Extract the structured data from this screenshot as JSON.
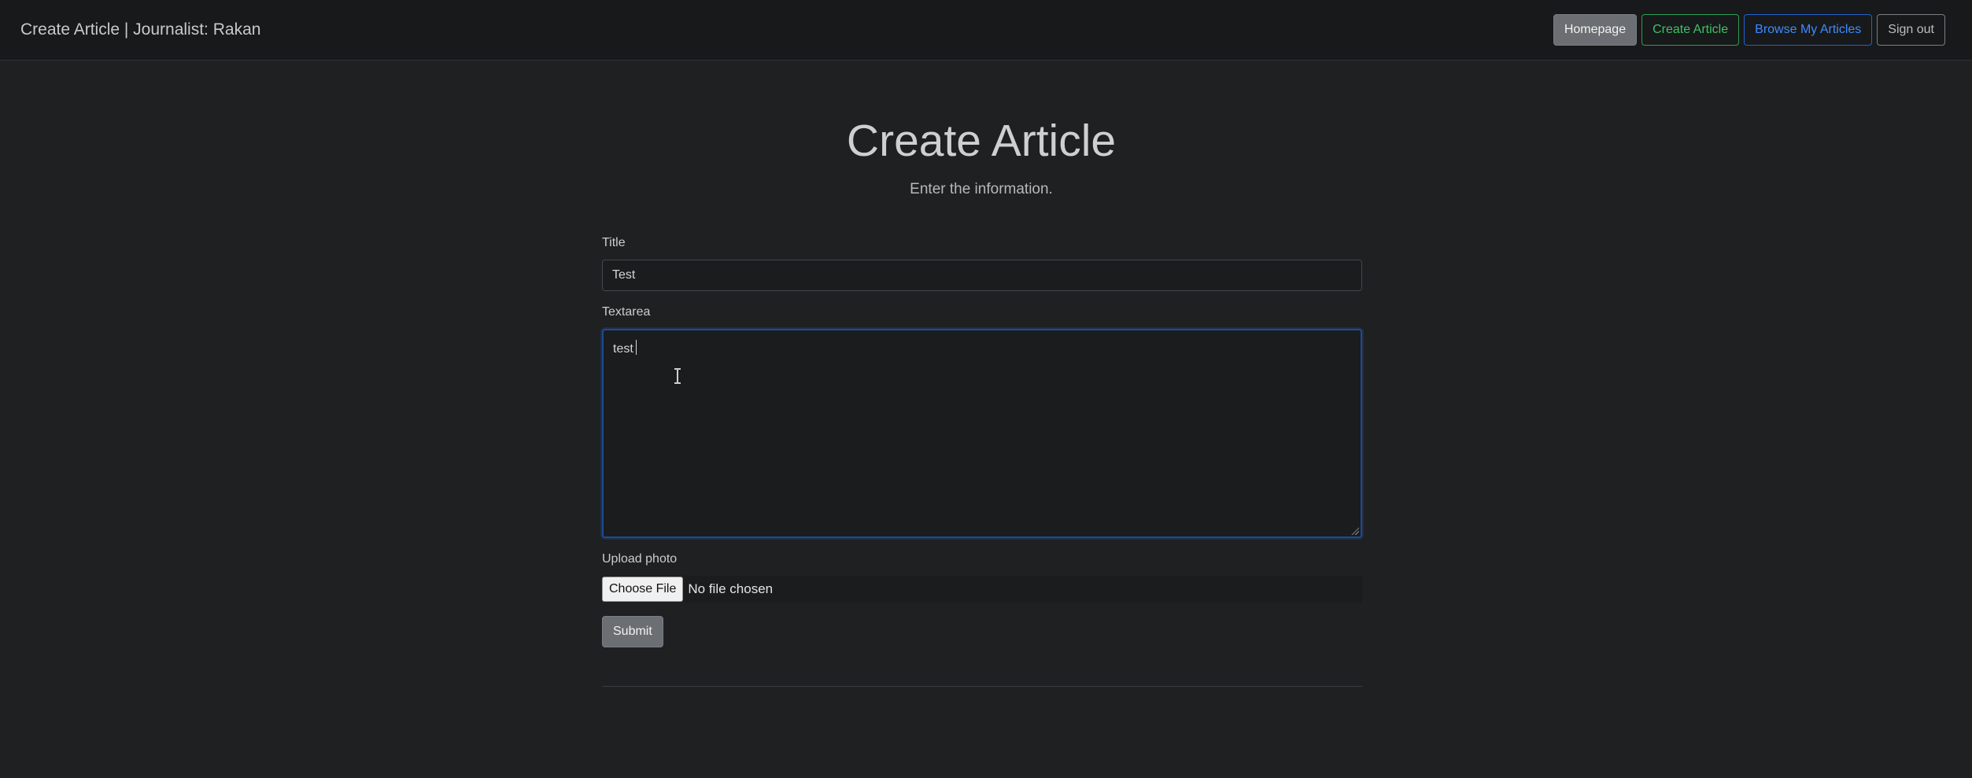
{
  "navbar": {
    "brand": "Create Article | Journalist: Rakan",
    "buttons": {
      "homepage": "Homepage",
      "create_article": "Create Article",
      "browse_my_articles": "Browse My Articles",
      "sign_out": "Sign out"
    }
  },
  "page": {
    "title": "Create Article",
    "subtitle": "Enter the information."
  },
  "form": {
    "title_label": "Title",
    "title_value": "Test",
    "textarea_label": "Textarea",
    "textarea_value": "test",
    "upload_label": "Upload photo",
    "choose_file_label": "Choose File",
    "file_status": "No file chosen",
    "submit_label": "Submit"
  },
  "colors": {
    "background": "#1e2022",
    "navbar": "#18191b",
    "create_accent": "#3fc066",
    "browse_accent": "#3d8bff",
    "focus_border": "#1d4c8f"
  }
}
